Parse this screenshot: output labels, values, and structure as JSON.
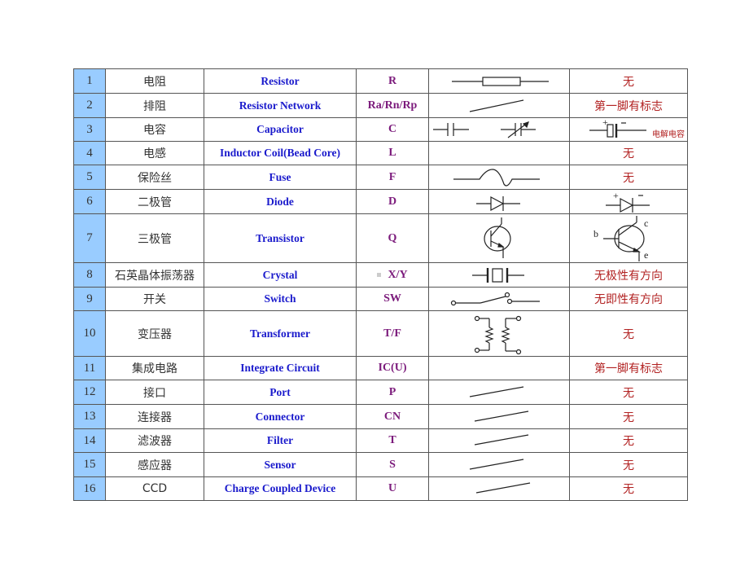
{
  "table": {
    "rows": [
      {
        "no": "1",
        "cn": "电阻",
        "en": "Resistor",
        "code": "R",
        "symbol": "resistor-symbol",
        "note": "无"
      },
      {
        "no": "2",
        "cn": "排阻",
        "en": "Resistor Network",
        "code": "Ra/Rn/Rp",
        "symbol": "placeholder-slash",
        "note": "第一脚有标志"
      },
      {
        "no": "3",
        "cn": "电容",
        "en": "Capacitor",
        "code": "C",
        "symbol": "capacitor-and-variable-capacitor-symbol",
        "note_symbol": "electrolytic-capacitor-symbol",
        "note_sub": "电解电容"
      },
      {
        "no": "4",
        "cn": "电感",
        "en": "Inductor Coil(Bead Core)",
        "code": "L",
        "symbol": "",
        "note": "无"
      },
      {
        "no": "5",
        "cn": "保险丝",
        "en": "Fuse",
        "code": "F",
        "symbol": "fuse-symbol",
        "note": "无"
      },
      {
        "no": "6",
        "cn": "二极管",
        "en": "Diode",
        "code": "D",
        "symbol": "diode-symbol",
        "note_symbol": "polarized-diode-symbol"
      },
      {
        "no": "7",
        "cn": "三极管",
        "en": "Transistor",
        "code": "Q",
        "symbol": "transistor-symbol",
        "note_symbol": "transistor-bce-symbol",
        "pins": {
          "b": "b",
          "c": "c",
          "e": "e"
        }
      },
      {
        "no": "8",
        "cn": "石英晶体振荡器",
        "en": "Crystal",
        "code": "X/Y",
        "symbol": "crystal-symbol",
        "note": "无极性有方向"
      },
      {
        "no": "9",
        "cn": "开关",
        "en": "Switch",
        "code": "SW",
        "symbol": "switch-symbol",
        "note": "无即性有方向"
      },
      {
        "no": "10",
        "cn": "变压器",
        "en": "Transformer",
        "code": "T/F",
        "symbol": "transformer-symbol",
        "note": "无"
      },
      {
        "no": "11",
        "cn": "集成电路",
        "en": "Integrate Circuit",
        "code": "IC(U)",
        "symbol": "",
        "note": "第一脚有标志"
      },
      {
        "no": "12",
        "cn": "接口",
        "en": "Port",
        "code": "P",
        "symbol": "placeholder-slash",
        "note": "无"
      },
      {
        "no": "13",
        "cn": "连接器",
        "en": "Connector",
        "code": "CN",
        "symbol": "placeholder-slash",
        "note": "无"
      },
      {
        "no": "14",
        "cn": "滤波器",
        "en": "Filter",
        "code": "T",
        "symbol": "placeholder-slash",
        "note": "无"
      },
      {
        "no": "15",
        "cn": "感应器",
        "en": "Sensor",
        "code": "S",
        "symbol": "placeholder-slash",
        "note": "无"
      },
      {
        "no": "16",
        "cn": "CCD",
        "en": "Charge Coupled Device",
        "code": "U",
        "symbol": "placeholder-slash",
        "note": "无"
      }
    ]
  },
  "colors": {
    "number_column_bg": "#99ccff",
    "english_name": "#1a1acc",
    "code": "#7b1a7b",
    "note": "#b22222"
  }
}
